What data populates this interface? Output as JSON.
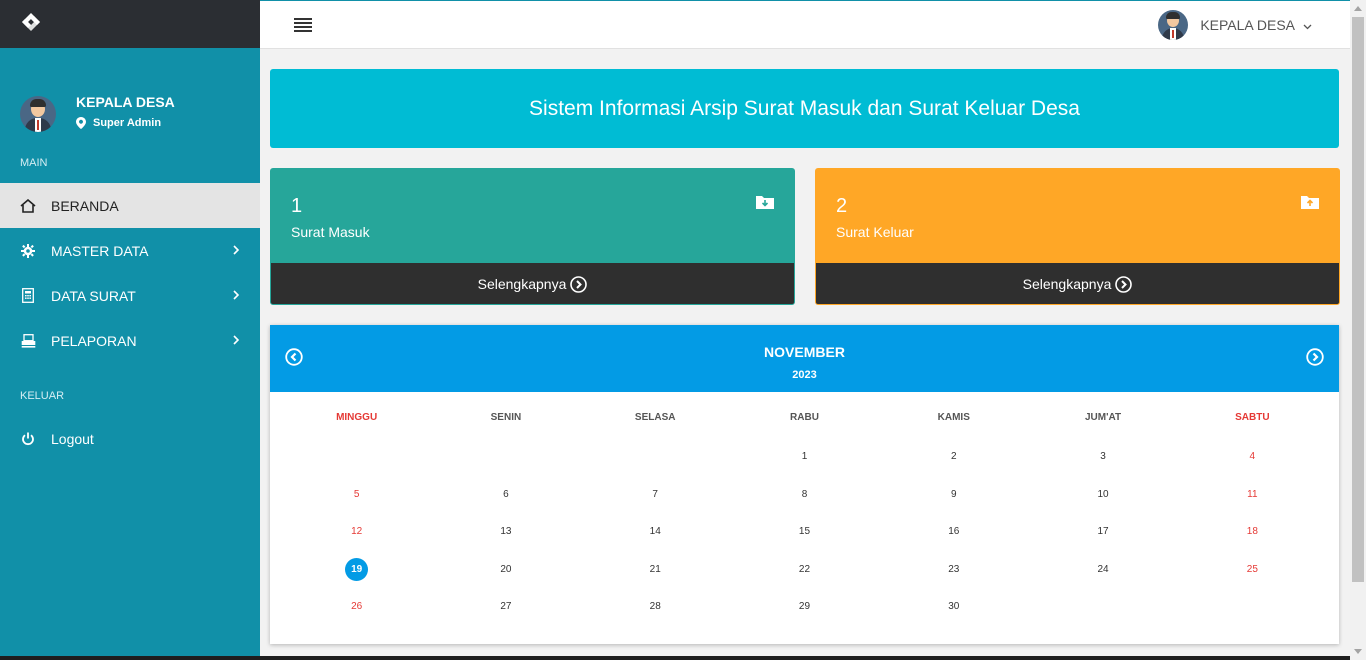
{
  "colors": {
    "sidebar": "#1190a8",
    "brand_bar": "#2b2e33",
    "banner": "#00bcd4",
    "masuk": "#26a69a",
    "keluar": "#ffa726",
    "calendar_header": "#039be5",
    "weekend": "#e53935"
  },
  "sidebar": {
    "user": {
      "name": "KEPALA DESA",
      "role": "Super Admin",
      "role_icon": "map-marker-icon"
    },
    "sections": {
      "main": "MAIN",
      "keluar": "KELUAR"
    },
    "items": [
      {
        "label": "BERANDA",
        "icon": "home-icon",
        "active": true
      },
      {
        "label": "MASTER DATA",
        "icon": "gear-icon"
      },
      {
        "label": "DATA SURAT",
        "icon": "calculator-icon"
      },
      {
        "label": "PELAPORAN",
        "icon": "printer-icon"
      }
    ],
    "logout": {
      "label": "Logout",
      "icon": "power-icon"
    }
  },
  "topbar": {
    "user_name": "KEPALA DESA"
  },
  "banner": {
    "title": "Sistem Informasi Arsip Surat Masuk dan Surat Keluar Desa"
  },
  "stats": {
    "masuk": {
      "count": "1",
      "label": "Surat Masuk",
      "more": "Selengkapnya",
      "icon": "folder-download-icon"
    },
    "keluar": {
      "count": "2",
      "label": "Surat Keluar",
      "more": "Selengkapnya",
      "icon": "folder-upload-icon"
    }
  },
  "calendar": {
    "month": "NOVEMBER",
    "year": "2023",
    "days": [
      "MINGGU",
      "SENIN",
      "SELASA",
      "RABU",
      "KAMIS",
      "JUM'AT",
      "SABTU"
    ],
    "weeks": [
      [
        "",
        "",
        "",
        "1",
        "2",
        "3",
        "4"
      ],
      [
        "5",
        "6",
        "7",
        "8",
        "9",
        "10",
        "11"
      ],
      [
        "12",
        "13",
        "14",
        "15",
        "16",
        "17",
        "18"
      ],
      [
        "19",
        "20",
        "21",
        "22",
        "23",
        "24",
        "25"
      ],
      [
        "26",
        "27",
        "28",
        "29",
        "30",
        "",
        ""
      ]
    ],
    "today": "19"
  }
}
